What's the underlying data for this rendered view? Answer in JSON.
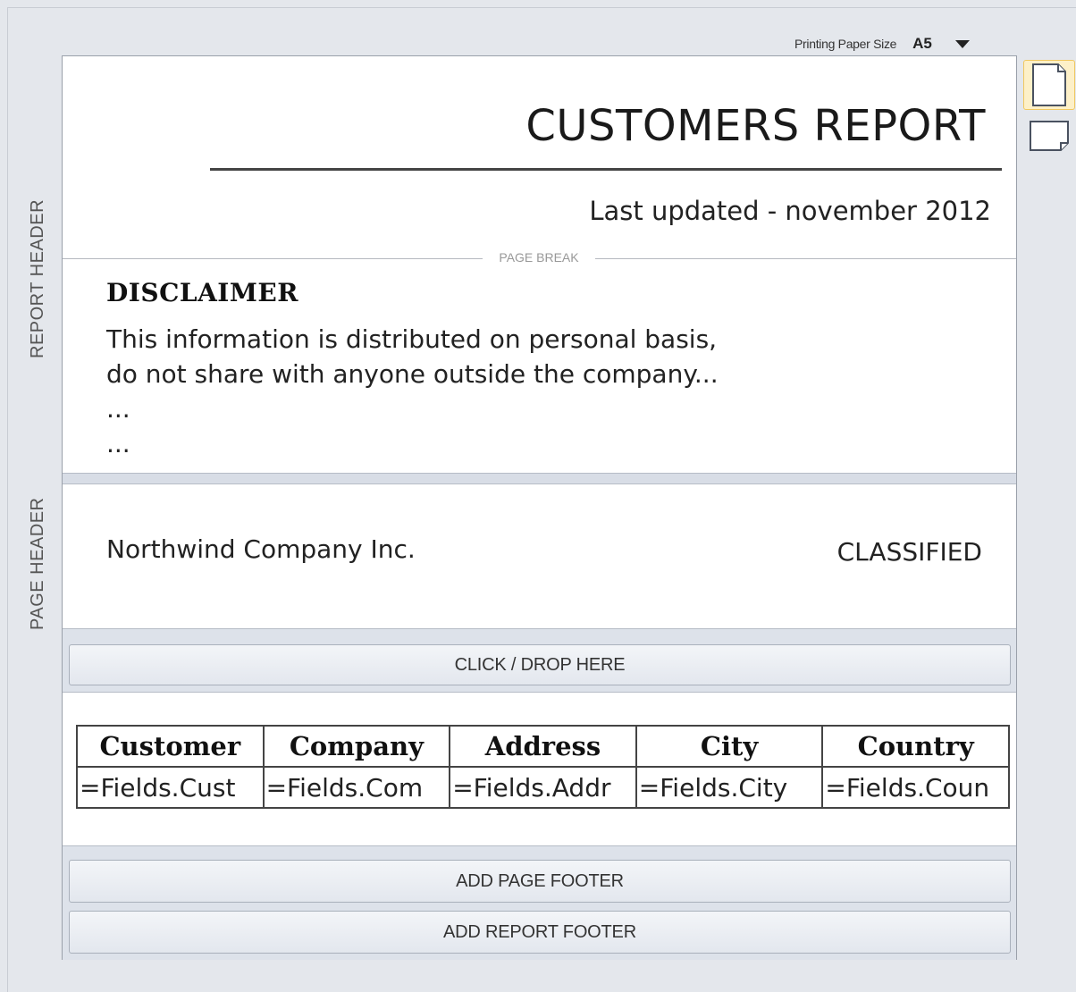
{
  "toolbar": {
    "paper_size_label": "Printing Paper Size",
    "paper_size_value": "A5",
    "dropdown_icon": "chevron-down-icon"
  },
  "orientation": {
    "options": [
      "portrait",
      "landscape"
    ],
    "selected": "portrait"
  },
  "sections": {
    "report_header_label": "REPORT HEADER",
    "page_header_label": "PAGE HEADER"
  },
  "report": {
    "title": "CUSTOMERS REPORT",
    "updated": "Last updated - november 2012",
    "page_break_label": "PAGE BREAK",
    "disclaimer_title": "DISCLAIMER",
    "disclaimer_text": "This information is distributed on personal basis,\ndo not share with anyone outside the company...\n...\n..."
  },
  "page_header": {
    "company": "Northwind Company Inc.",
    "classification": "CLASSIFIED"
  },
  "buttons": {
    "drop": "CLICK / DROP HERE",
    "add_page_footer": "ADD PAGE FOOTER",
    "add_report_footer": "ADD REPORT FOOTER"
  },
  "table": {
    "headers": [
      "Customer",
      "Company",
      "Address",
      "City",
      "Country"
    ],
    "row": [
      "=Fields.Cust",
      "=Fields.Com",
      "=Fields.Addr",
      "=Fields.City",
      "=Fields.Coun"
    ]
  },
  "colors": {
    "background": "#e4e7ec",
    "page": "#ffffff",
    "selected_highlight": "#fdf0c8"
  }
}
